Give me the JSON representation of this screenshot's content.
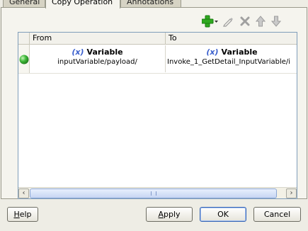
{
  "tabs": [
    {
      "label": "General"
    },
    {
      "label": "Copy Operation"
    },
    {
      "label": "Annotations"
    }
  ],
  "toolbar": {
    "add": {
      "icon": "add-icon",
      "color": "#2ea81f"
    },
    "edit": {
      "icon": "pencil-icon"
    },
    "delete": {
      "icon": "delete-icon"
    },
    "up": {
      "icon": "move-up-icon"
    },
    "down": {
      "icon": "move-down-icon"
    }
  },
  "table": {
    "columns": [
      {
        "label": "From"
      },
      {
        "label": "To"
      }
    ],
    "rows": [
      {
        "status": {
          "icon": "status-ok-icon",
          "color": "#3fb83a"
        },
        "from": {
          "symbol": "(x)",
          "type": "Variable",
          "path": "inputVariable/payload/"
        },
        "to": {
          "symbol": "(x)",
          "type": "Variable",
          "path": "Invoke_1_GetDetail_InputVariable/i"
        }
      }
    ]
  },
  "footer": {
    "help": {
      "label": "Help",
      "mnemonic": "H",
      "rest": "elp"
    },
    "apply": {
      "label": "Apply",
      "mnemonic": "A",
      "rest": "pply"
    },
    "ok": {
      "label": "OK"
    },
    "cancel": {
      "label": "Cancel"
    }
  }
}
